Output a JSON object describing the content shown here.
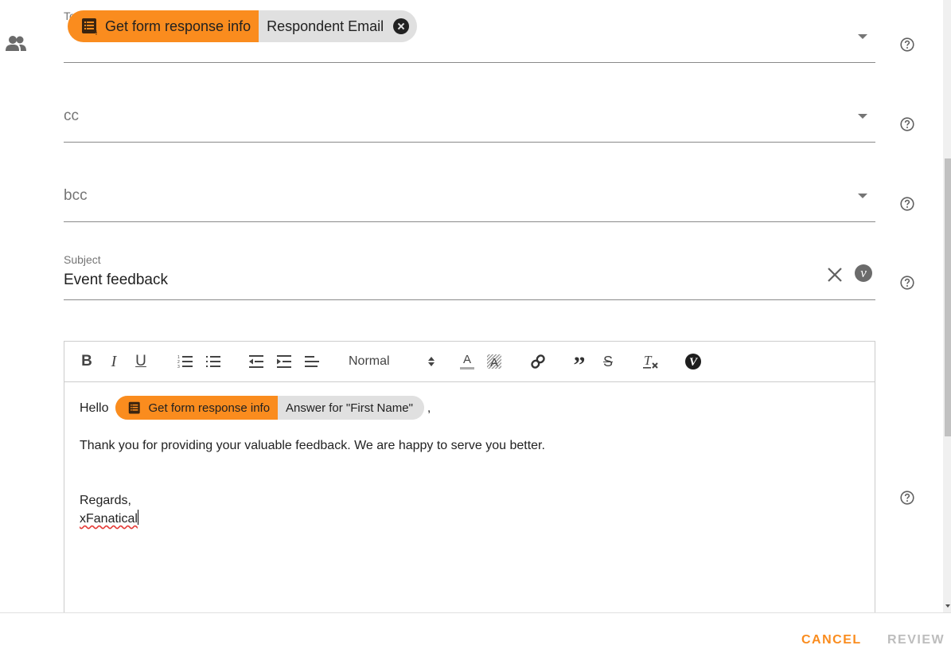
{
  "to_field": {
    "label": "To",
    "chip": {
      "source_label": "Get form response info",
      "value_label": "Respondent Email",
      "source_icon": "form-response-icon",
      "remove_icon": "close-circle-icon"
    },
    "dropdown_icon": "chevron-down-icon",
    "help_icon": "help-circle-icon",
    "leading_icon": "people-icon"
  },
  "cc_field": {
    "placeholder": "cc",
    "dropdown_icon": "chevron-down-icon",
    "help_icon": "help-circle-icon"
  },
  "bcc_field": {
    "placeholder": "bcc",
    "dropdown_icon": "chevron-down-icon",
    "help_icon": "help-circle-icon"
  },
  "subject_field": {
    "label": "Subject",
    "value": "Event feedback",
    "clear_icon": "close-icon",
    "variable_icon": "variable-v-icon",
    "variable_glyph": "v",
    "help_icon": "help-circle-icon"
  },
  "editor": {
    "toolbar": {
      "buttons": [
        "bold",
        "italic",
        "underline",
        "ordered-list",
        "bullet-list",
        "outdent",
        "indent",
        "align",
        "text-color",
        "background-color",
        "link",
        "blockquote",
        "strikethrough",
        "clear-formatting",
        "insert-variable"
      ],
      "bold_glyph": "B",
      "italic_glyph": "I",
      "underline_glyph": "U",
      "text_color_glyph": "A",
      "bg_color_glyph": "A",
      "blockquote_glyph": "”",
      "strike_glyph": "S",
      "clear_glyph": "T",
      "variable_glyph": "V",
      "format_select": "Normal"
    },
    "body": {
      "greeting": "Hello",
      "chip": {
        "source_label": "Get form response info",
        "value_label": "Answer for \"First Name\""
      },
      "after_chip": ",",
      "paragraph": "Thank you for providing your valuable feedback. We are happy to serve you better.",
      "closing": "Regards,",
      "signature": "xFanatical"
    },
    "help_icon": "help-circle-icon"
  },
  "footer": {
    "cancel_label": "CANCEL",
    "review_label": "REVIEW"
  },
  "colors": {
    "accent": "#fa8c1e",
    "chip_bg": "#e0e0e0",
    "disabled": "#bdbdbd",
    "underline": "#8a8a8a"
  }
}
